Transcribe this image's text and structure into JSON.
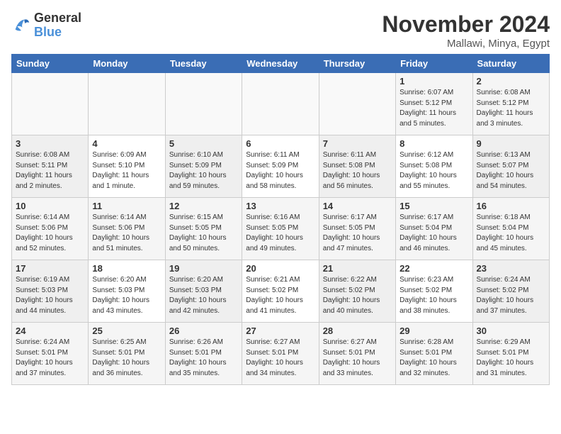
{
  "logo": {
    "line1": "General",
    "line2": "Blue"
  },
  "title": "November 2024",
  "subtitle": "Mallawi, Minya, Egypt",
  "days_of_week": [
    "Sunday",
    "Monday",
    "Tuesday",
    "Wednesday",
    "Thursday",
    "Friday",
    "Saturday"
  ],
  "weeks": [
    [
      {
        "day": "",
        "info": ""
      },
      {
        "day": "",
        "info": ""
      },
      {
        "day": "",
        "info": ""
      },
      {
        "day": "",
        "info": ""
      },
      {
        "day": "",
        "info": ""
      },
      {
        "day": "1",
        "info": "Sunrise: 6:07 AM\nSunset: 5:12 PM\nDaylight: 11 hours\nand 5 minutes."
      },
      {
        "day": "2",
        "info": "Sunrise: 6:08 AM\nSunset: 5:12 PM\nDaylight: 11 hours\nand 3 minutes."
      }
    ],
    [
      {
        "day": "3",
        "info": "Sunrise: 6:08 AM\nSunset: 5:11 PM\nDaylight: 11 hours\nand 2 minutes."
      },
      {
        "day": "4",
        "info": "Sunrise: 6:09 AM\nSunset: 5:10 PM\nDaylight: 11 hours\nand 1 minute."
      },
      {
        "day": "5",
        "info": "Sunrise: 6:10 AM\nSunset: 5:09 PM\nDaylight: 10 hours\nand 59 minutes."
      },
      {
        "day": "6",
        "info": "Sunrise: 6:11 AM\nSunset: 5:09 PM\nDaylight: 10 hours\nand 58 minutes."
      },
      {
        "day": "7",
        "info": "Sunrise: 6:11 AM\nSunset: 5:08 PM\nDaylight: 10 hours\nand 56 minutes."
      },
      {
        "day": "8",
        "info": "Sunrise: 6:12 AM\nSunset: 5:08 PM\nDaylight: 10 hours\nand 55 minutes."
      },
      {
        "day": "9",
        "info": "Sunrise: 6:13 AM\nSunset: 5:07 PM\nDaylight: 10 hours\nand 54 minutes."
      }
    ],
    [
      {
        "day": "10",
        "info": "Sunrise: 6:14 AM\nSunset: 5:06 PM\nDaylight: 10 hours\nand 52 minutes."
      },
      {
        "day": "11",
        "info": "Sunrise: 6:14 AM\nSunset: 5:06 PM\nDaylight: 10 hours\nand 51 minutes."
      },
      {
        "day": "12",
        "info": "Sunrise: 6:15 AM\nSunset: 5:05 PM\nDaylight: 10 hours\nand 50 minutes."
      },
      {
        "day": "13",
        "info": "Sunrise: 6:16 AM\nSunset: 5:05 PM\nDaylight: 10 hours\nand 49 minutes."
      },
      {
        "day": "14",
        "info": "Sunrise: 6:17 AM\nSunset: 5:05 PM\nDaylight: 10 hours\nand 47 minutes."
      },
      {
        "day": "15",
        "info": "Sunrise: 6:17 AM\nSunset: 5:04 PM\nDaylight: 10 hours\nand 46 minutes."
      },
      {
        "day": "16",
        "info": "Sunrise: 6:18 AM\nSunset: 5:04 PM\nDaylight: 10 hours\nand 45 minutes."
      }
    ],
    [
      {
        "day": "17",
        "info": "Sunrise: 6:19 AM\nSunset: 5:03 PM\nDaylight: 10 hours\nand 44 minutes."
      },
      {
        "day": "18",
        "info": "Sunrise: 6:20 AM\nSunset: 5:03 PM\nDaylight: 10 hours\nand 43 minutes."
      },
      {
        "day": "19",
        "info": "Sunrise: 6:20 AM\nSunset: 5:03 PM\nDaylight: 10 hours\nand 42 minutes."
      },
      {
        "day": "20",
        "info": "Sunrise: 6:21 AM\nSunset: 5:02 PM\nDaylight: 10 hours\nand 41 minutes."
      },
      {
        "day": "21",
        "info": "Sunrise: 6:22 AM\nSunset: 5:02 PM\nDaylight: 10 hours\nand 40 minutes."
      },
      {
        "day": "22",
        "info": "Sunrise: 6:23 AM\nSunset: 5:02 PM\nDaylight: 10 hours\nand 38 minutes."
      },
      {
        "day": "23",
        "info": "Sunrise: 6:24 AM\nSunset: 5:02 PM\nDaylight: 10 hours\nand 37 minutes."
      }
    ],
    [
      {
        "day": "24",
        "info": "Sunrise: 6:24 AM\nSunset: 5:01 PM\nDaylight: 10 hours\nand 37 minutes."
      },
      {
        "day": "25",
        "info": "Sunrise: 6:25 AM\nSunset: 5:01 PM\nDaylight: 10 hours\nand 36 minutes."
      },
      {
        "day": "26",
        "info": "Sunrise: 6:26 AM\nSunset: 5:01 PM\nDaylight: 10 hours\nand 35 minutes."
      },
      {
        "day": "27",
        "info": "Sunrise: 6:27 AM\nSunset: 5:01 PM\nDaylight: 10 hours\nand 34 minutes."
      },
      {
        "day": "28",
        "info": "Sunrise: 6:27 AM\nSunset: 5:01 PM\nDaylight: 10 hours\nand 33 minutes."
      },
      {
        "day": "29",
        "info": "Sunrise: 6:28 AM\nSunset: 5:01 PM\nDaylight: 10 hours\nand 32 minutes."
      },
      {
        "day": "30",
        "info": "Sunrise: 6:29 AM\nSunset: 5:01 PM\nDaylight: 10 hours\nand 31 minutes."
      }
    ]
  ]
}
